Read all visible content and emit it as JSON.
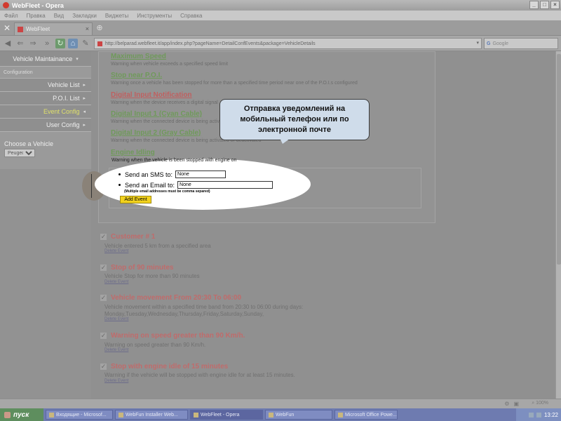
{
  "window": {
    "title": "WebFleet - Opera",
    "controls": [
      "_",
      "□",
      "×"
    ]
  },
  "menu": [
    "Файл",
    "Правка",
    "Вид",
    "Закладки",
    "Виджеты",
    "Инструменты",
    "Справка"
  ],
  "tab": {
    "title": "WebFleet",
    "close": "×"
  },
  "address": {
    "url": "http://belparad.webfleet.it/app/index.php?pageName=DetailConfEvents&package=VehicleDetails",
    "search_placeholder": "Google"
  },
  "sidebar": {
    "header": "Vehicle Maintainance",
    "section": "Configuration",
    "items": [
      {
        "label": "Vehicle List",
        "arrow": "▸"
      },
      {
        "label": "P.O.I. List",
        "arrow": "▸"
      },
      {
        "label": "Event Config",
        "arrow": "◂"
      },
      {
        "label": "User Config",
        "arrow": "▸"
      }
    ],
    "choose_label": "Choose a Vehicle",
    "vehicle_selected": "Peugeot"
  },
  "events_available": [
    {
      "name": "Maximum Speed",
      "desc": "Warning when vehicle exceeds a specified speed limit"
    },
    {
      "name": "Stop near P.O.I.",
      "desc": "Warning once a vehicle has been stopped for more than a specified time period near one of the P.O.I.s configured"
    },
    {
      "name": "Digital Input Notification",
      "desc": "Warning when the device receives a digital signal"
    },
    {
      "name": "Digital Input 1 (Cyan Cable)",
      "desc": "Warning when the connected device is being activated"
    },
    {
      "name": "Digital Input 2 (Gray Cable)",
      "desc": "Warning when the connected device is being activated or deactivated"
    },
    {
      "name": "Engine Idling",
      "desc": "Warning when the vehicle is been stopped with engine on"
    }
  ],
  "notification_form": {
    "sms_label": "Send an SMS to:",
    "sms_value": "None",
    "email_label": "Send an Email to:",
    "email_value": "None",
    "note": "(Multiple email addresses must be comma separed)",
    "add_button": "Add Event"
  },
  "callout": {
    "text": "Отправка уведомлений на мобильный телефон или по электронной почте"
  },
  "configured_events": [
    {
      "name": "Customer # 1",
      "desc": "Vehicle entered 5 km from a specified area",
      "delete": "Delete Event"
    },
    {
      "name": "Stop of 90 minutes",
      "desc": "Vehicle Stop for more than 90 minutes",
      "delete": "Delete Event"
    },
    {
      "name": "Vehicle movement From 20:30 To 06:00",
      "desc": "Vehicle movement within a specified time band from 20:30 to 06:00 during days:",
      "desc2": "Monday,Tuesday,Wednesday,Thursday,Friday,Saturday,Sunday,",
      "delete": "Delete Event"
    },
    {
      "name": "Warning on speed greater than 90 Km/h.",
      "desc": "Warning on speed greater than 90 Km/h.",
      "delete": "Delete Event"
    },
    {
      "name": "Stop with engine idle of 15 minutes",
      "desc": "Warning if the vehicle will be stopped with engine idle for at least 15 minutes.",
      "delete": "Delete Event"
    }
  ],
  "status": {
    "zoom": "100%"
  },
  "taskbar": {
    "start": "пуск",
    "tasks": [
      "Входящие - Microsof...",
      "WebFun Installer Web...",
      "WebFleet - Opera",
      "WebFun",
      "Microsoft Office Powe..."
    ],
    "clock": "13:22"
  }
}
